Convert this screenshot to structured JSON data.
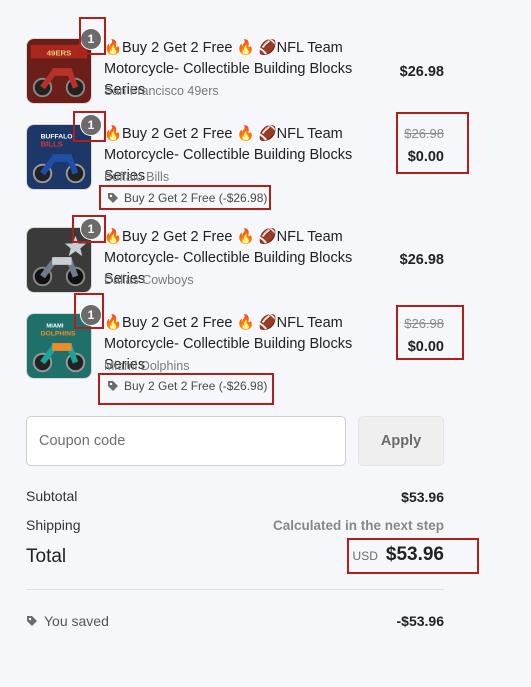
{
  "items": [
    {
      "quantity": "1",
      "title": "🔥Buy 2 Get 2 Free 🔥 🏈NFL Team Motorcycle- Collectible Building Blocks Series",
      "variant": "San Francisco 49ers",
      "price": "$26.98",
      "original_price": null,
      "discount": null,
      "thumb_colors": {
        "bg": "#6b1f18",
        "bike": "#b8312a",
        "accent": "#e8c870"
      }
    },
    {
      "quantity": "1",
      "title": "🔥Buy 2 Get 2 Free 🔥 🏈NFL Team Motorcycle- Collectible Building Blocks Series",
      "variant": "Buffalo Bills",
      "price": "$0.00",
      "original_price": "$26.98",
      "discount": "Buy 2 Get 2 Free (-$26.98)",
      "thumb_colors": {
        "bg": "#1d3768",
        "bike": "#1f4fa8",
        "accent": "#d23a3a"
      }
    },
    {
      "quantity": "1",
      "title": "🔥Buy 2 Get 2 Free 🔥 🏈NFL Team Motorcycle- Collectible Building Blocks Series",
      "variant": "Dallas Cowboys",
      "price": "$26.98",
      "original_price": null,
      "discount": null,
      "thumb_colors": {
        "bg": "#3a3a3a",
        "bike": "#6d7d8f",
        "accent": "#c9ced6"
      }
    },
    {
      "quantity": "1",
      "title": "🔥Buy 2 Get 2 Free 🔥 🏈NFL Team Motorcycle- Collectible Building Blocks Series",
      "variant": "Miami Dolphins",
      "price": "$0.00",
      "original_price": "$26.98",
      "discount": "Buy 2 Get 2 Free (-$26.98)",
      "thumb_colors": {
        "bg": "#1f6f6a",
        "bike": "#1aa39a",
        "accent": "#f08a2a"
      }
    }
  ],
  "coupon": {
    "placeholder": "Coupon code",
    "apply_label": "Apply"
  },
  "summary": {
    "subtotal_label": "Subtotal",
    "subtotal_value": "$53.96",
    "shipping_label": "Shipping",
    "shipping_value": "Calculated in the next step",
    "total_label": "Total",
    "currency": "USD",
    "total_value": "$53.96",
    "saved_label": "You saved",
    "saved_value": "-$53.96"
  },
  "colors": {
    "highlight_box": "#b0201a",
    "background": "#f6f7fa"
  }
}
